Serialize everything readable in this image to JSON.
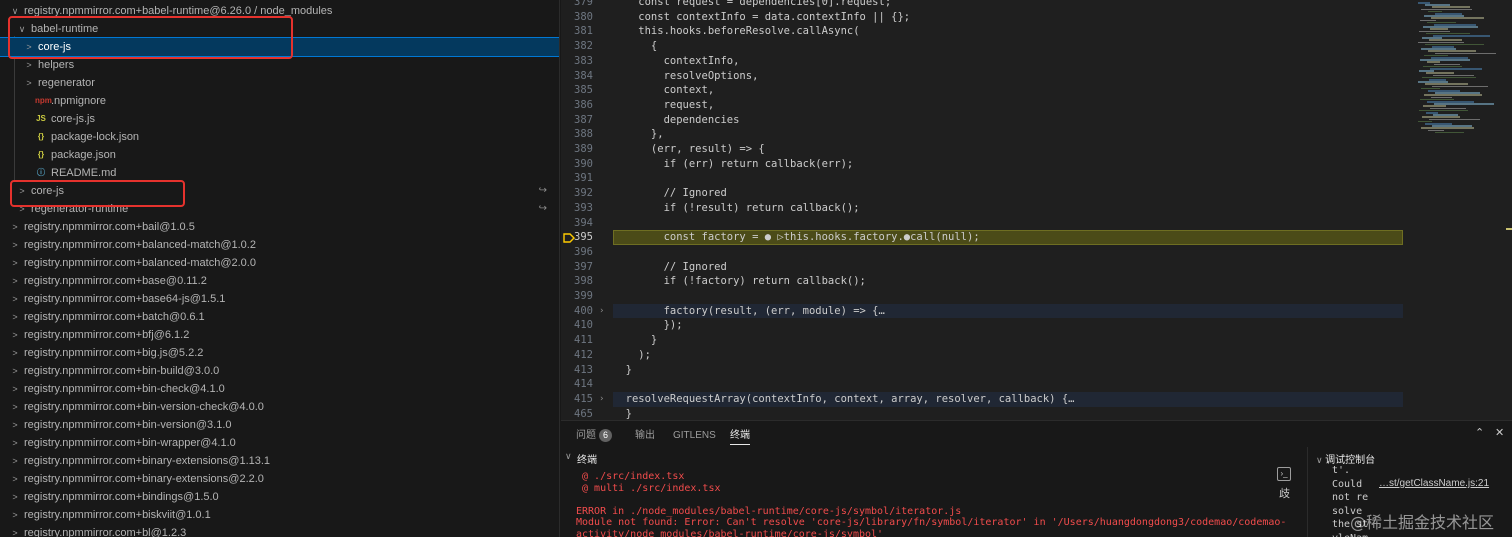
{
  "explorer": {
    "rows": [
      {
        "label": "registry.npmmirror.com+babel-runtime@6.26.0 / node_modules",
        "chev": "∨",
        "icon": "",
        "link": ""
      },
      {
        "label": "babel-runtime",
        "chev": "∨",
        "icon": "",
        "link": ""
      },
      {
        "label": "core-js",
        "chev": ">",
        "icon": "",
        "link": ""
      },
      {
        "label": "helpers",
        "chev": ">",
        "icon": "",
        "link": ""
      },
      {
        "label": "regenerator",
        "chev": ">",
        "icon": "",
        "link": ""
      },
      {
        "label": ".npmignore",
        "chev": "",
        "icon": "npm",
        "link": ""
      },
      {
        "label": "core-js.js",
        "chev": "",
        "icon": "JS",
        "link": ""
      },
      {
        "label": "package-lock.json",
        "chev": "",
        "icon": "{}",
        "link": ""
      },
      {
        "label": "package.json",
        "chev": "",
        "icon": "{}",
        "link": ""
      },
      {
        "label": "README.md",
        "chev": "",
        "icon": "ⓘ",
        "link": ""
      },
      {
        "label": "core-js",
        "chev": ">",
        "icon": "",
        "link": "↪"
      },
      {
        "label": "regenerator-runtime",
        "chev": ">",
        "icon": "",
        "link": "↪"
      },
      {
        "label": "registry.npmmirror.com+bail@1.0.5",
        "chev": ">",
        "icon": "",
        "link": ""
      },
      {
        "label": "registry.npmmirror.com+balanced-match@1.0.2",
        "chev": ">",
        "icon": "",
        "link": ""
      },
      {
        "label": "registry.npmmirror.com+balanced-match@2.0.0",
        "chev": ">",
        "icon": "",
        "link": ""
      },
      {
        "label": "registry.npmmirror.com+base@0.11.2",
        "chev": ">",
        "icon": "",
        "link": ""
      },
      {
        "label": "registry.npmmirror.com+base64-js@1.5.1",
        "chev": ">",
        "icon": "",
        "link": ""
      },
      {
        "label": "registry.npmmirror.com+batch@0.6.1",
        "chev": ">",
        "icon": "",
        "link": ""
      },
      {
        "label": "registry.npmmirror.com+bfj@6.1.2",
        "chev": ">",
        "icon": "",
        "link": ""
      },
      {
        "label": "registry.npmmirror.com+big.js@5.2.2",
        "chev": ">",
        "icon": "",
        "link": ""
      },
      {
        "label": "registry.npmmirror.com+bin-build@3.0.0",
        "chev": ">",
        "icon": "",
        "link": ""
      },
      {
        "label": "registry.npmmirror.com+bin-check@4.1.0",
        "chev": ">",
        "icon": "",
        "link": ""
      },
      {
        "label": "registry.npmmirror.com+bin-version-check@4.0.0",
        "chev": ">",
        "icon": "",
        "link": ""
      },
      {
        "label": "registry.npmmirror.com+bin-version@3.1.0",
        "chev": ">",
        "icon": "",
        "link": ""
      },
      {
        "label": "registry.npmmirror.com+bin-wrapper@4.1.0",
        "chev": ">",
        "icon": "",
        "link": ""
      },
      {
        "label": "registry.npmmirror.com+binary-extensions@1.13.1",
        "chev": ">",
        "icon": "",
        "link": ""
      },
      {
        "label": "registry.npmmirror.com+binary-extensions@2.2.0",
        "chev": ">",
        "icon": "",
        "link": ""
      },
      {
        "label": "registry.npmmirror.com+bindings@1.5.0",
        "chev": ">",
        "icon": "",
        "link": ""
      },
      {
        "label": "registry.npmmirror.com+biskviit@1.0.1",
        "chev": ">",
        "icon": "",
        "link": ""
      },
      {
        "label": "registry.npmmirror.com+bl@1.2.3",
        "chev": ">",
        "icon": "",
        "link": ""
      }
    ]
  },
  "editor": {
    "lines": [
      {
        "n": "379",
        "t": "    const request = dependencies[0].request;"
      },
      {
        "n": "380",
        "t": "    const contextInfo = data.contextInfo || {};"
      },
      {
        "n": "381",
        "t": "    this.hooks.beforeResolve.callAsync("
      },
      {
        "n": "382",
        "t": "      {"
      },
      {
        "n": "383",
        "t": "        contextInfo,"
      },
      {
        "n": "384",
        "t": "        resolveOptions,"
      },
      {
        "n": "385",
        "t": "        context,"
      },
      {
        "n": "386",
        "t": "        request,"
      },
      {
        "n": "387",
        "t": "        dependencies"
      },
      {
        "n": "388",
        "t": "      },"
      },
      {
        "n": "389",
        "t": "      (err, result) => {"
      },
      {
        "n": "390",
        "t": "        if (err) return callback(err);"
      },
      {
        "n": "391",
        "t": ""
      },
      {
        "n": "392",
        "t": "        // Ignored"
      },
      {
        "n": "393",
        "t": "        if (!result) return callback();"
      },
      {
        "n": "394",
        "t": ""
      },
      {
        "n": "395",
        "t": "        const factory = ● ▷this.hooks.factory.●call(null);"
      },
      {
        "n": "396",
        "t": ""
      },
      {
        "n": "397",
        "t": "        // Ignored"
      },
      {
        "n": "398",
        "t": "        if (!factory) return callback();"
      },
      {
        "n": "399",
        "t": ""
      },
      {
        "n": "400",
        "t": "        factory(result, (err, module) => {…"
      },
      {
        "n": "410",
        "t": "        });"
      },
      {
        "n": "411",
        "t": "      }"
      },
      {
        "n": "412",
        "t": "    );"
      },
      {
        "n": "413",
        "t": "  }"
      },
      {
        "n": "414",
        "t": ""
      },
      {
        "n": "415",
        "t": "  resolveRequestArray(contextInfo, context, array, resolver, callback) {…"
      },
      {
        "n": "465",
        "t": "  }"
      }
    ]
  },
  "panel": {
    "tabs": [
      {
        "label": "问题",
        "badge": "6"
      },
      {
        "label": "输出",
        "badge": ""
      },
      {
        "label": "GITLENS",
        "badge": ""
      },
      {
        "label": "终端",
        "badge": ""
      }
    ],
    "terminal_title": "终端",
    "terminal_lines": [
      " @ ./src/index.tsx",
      " @ multi ./src/index.tsx",
      "",
      "ERROR in ./node_modules/babel-runtime/core-js/symbol/iterator.js",
      "Module not found: Error: Can't resolve 'core-js/library/fn/symbol/iterator' in '/Users/huangdongdong3/codemao/codemao-",
      "activity/node_modules/babel-runtime/core-js/symbol'"
    ],
    "debug_title": "调试控制台",
    "debug_lines": [
      "t'.",
      "Could",
      "not re",
      "solve",
      "the st",
      "yleNam"
    ],
    "debug_link": "…st/getClassName.js:21",
    "terminal_side_icons": [
      "launch-profile-icon",
      "kill-terminal-icon"
    ],
    "terminal_side_label": "歧"
  },
  "watermark": "@稀土掘金技术社区",
  "colors": {
    "selection": "#04395e",
    "annotation_red": "#e5322d",
    "breakpoint_line": "#4b4b18",
    "error_text": "#f14c4c"
  }
}
